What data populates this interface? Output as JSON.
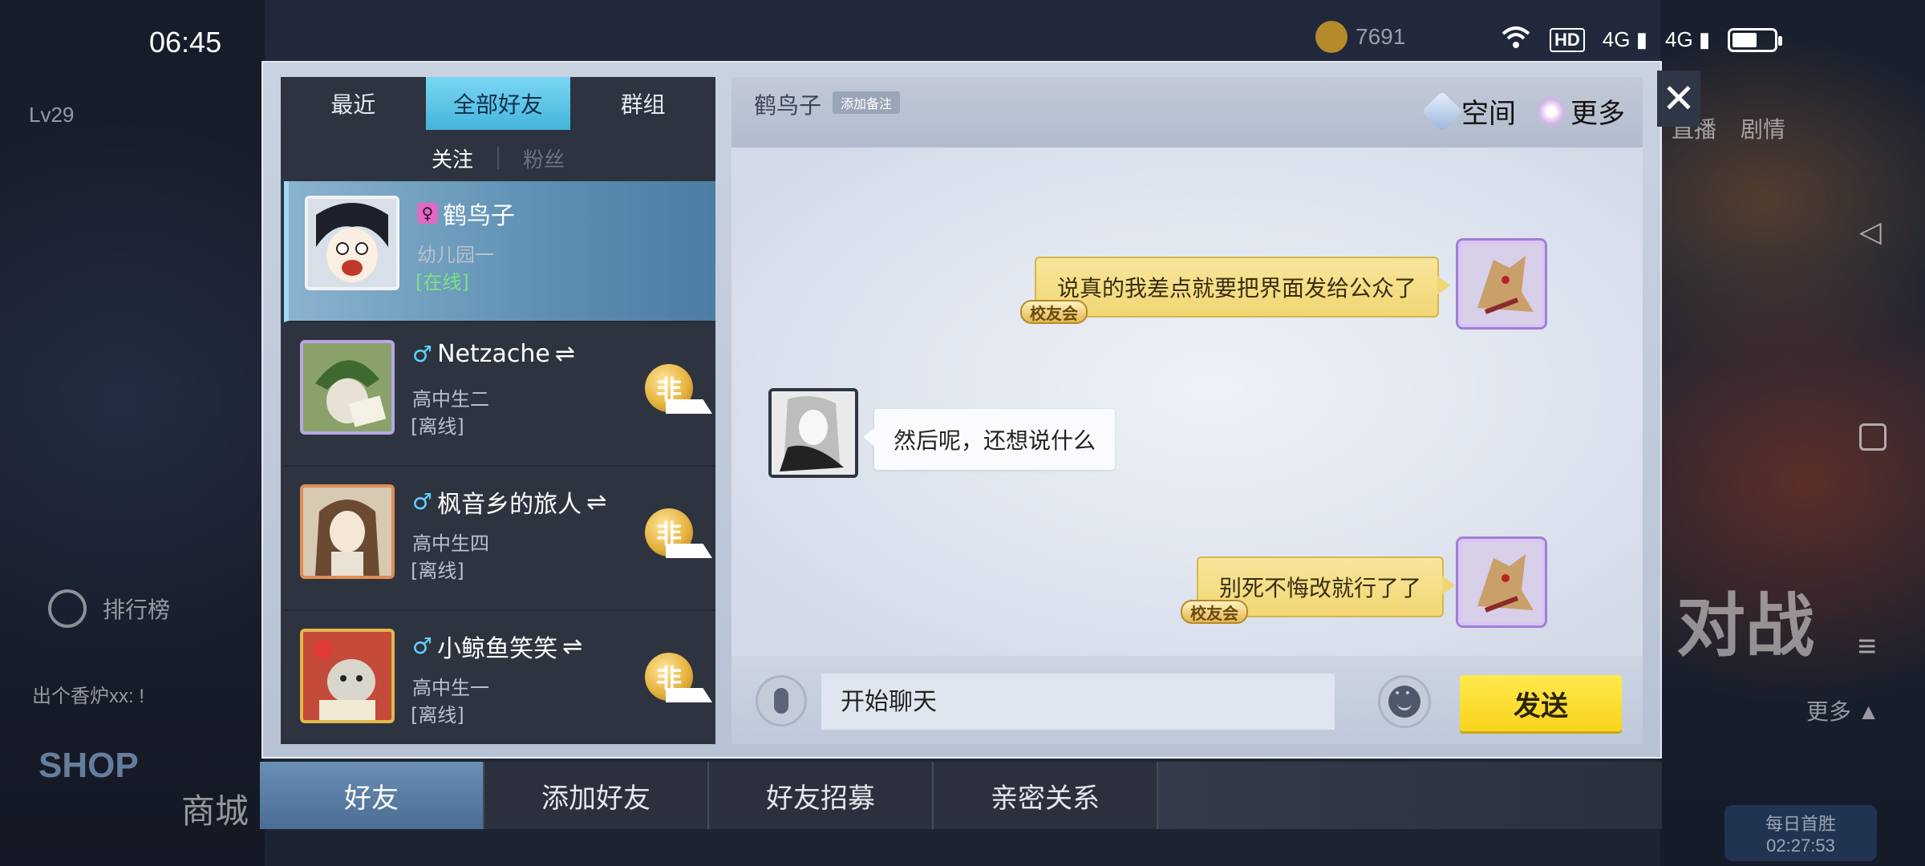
{
  "status_bar": {
    "time": "06:45",
    "network_hd": "HD",
    "net1": "4G",
    "net2": "4G",
    "battery_level": 0.6
  },
  "background": {
    "level": "Lv29",
    "coins": "7691",
    "ranking": "排行榜",
    "message": "出个香炉xx: !",
    "shop_en": "SHOP",
    "shop_cn": "商城",
    "live": "直播",
    "drama": "剧情",
    "more": "更多 ▲",
    "daily_first_win": "每日首胜",
    "countdown": "02:27:53",
    "battle_text": "对战"
  },
  "friend_panel": {
    "tabs": [
      {
        "label": "最近",
        "active": false
      },
      {
        "label": "全部好友",
        "active": true
      },
      {
        "label": "群组",
        "active": false
      }
    ],
    "sub_tabs": [
      {
        "label": "关注",
        "active": true
      },
      {
        "label": "粉丝",
        "active": false
      }
    ],
    "friends": [
      {
        "name": "鹤鸟子",
        "gender": "female",
        "gender_symbol": "♀",
        "grade": "幼儿园一",
        "status": "[在线]",
        "online": true,
        "selected": true,
        "mutual": false,
        "medal": ""
      },
      {
        "name": "Netzache",
        "gender": "male",
        "gender_symbol": "♂",
        "mutual_symbol": "⇌",
        "grade": "高中生二",
        "status": "[离线]",
        "online": false,
        "selected": false,
        "mutual": true,
        "medal": "非"
      },
      {
        "name": "枫音乡的旅人",
        "gender": "male",
        "gender_symbol": "♂",
        "mutual_symbol": "⇌",
        "grade": "高中生四",
        "status": "[离线]",
        "online": false,
        "selected": false,
        "mutual": true,
        "medal": "非"
      },
      {
        "name": "小鲸鱼笑笑",
        "gender": "male",
        "gender_symbol": "♂",
        "mutual_symbol": "⇌",
        "grade": "高中生一",
        "status": "[离线]",
        "online": false,
        "selected": false,
        "mutual": true,
        "medal": "非"
      }
    ]
  },
  "chat": {
    "contact_name": "鹤鸟子",
    "add_note": "添加备注",
    "space_label": "空间",
    "more_label": "更多",
    "messages": [
      {
        "from": "self",
        "text": "说真的我差点就要把界面发给公众了",
        "badge": "校友会"
      },
      {
        "from": "other",
        "text": "然后呢，还想说什么"
      },
      {
        "from": "self",
        "text": "别死不悔改就行了了",
        "badge": "校友会"
      }
    ],
    "input_placeholder": "开始聊天",
    "send_label": "发送",
    "close_symbol": "✕"
  },
  "bottom_tabs": [
    {
      "label": "好友",
      "active": true
    },
    {
      "label": "添加好友",
      "active": false
    },
    {
      "label": "好友招募",
      "active": false
    },
    {
      "label": "亲密关系",
      "active": false
    }
  ],
  "colors": {
    "accent_tab": "#44b4dc",
    "send_button": "#f8d41c",
    "online": "#7be37b",
    "self_bubble": "#f1d673"
  }
}
